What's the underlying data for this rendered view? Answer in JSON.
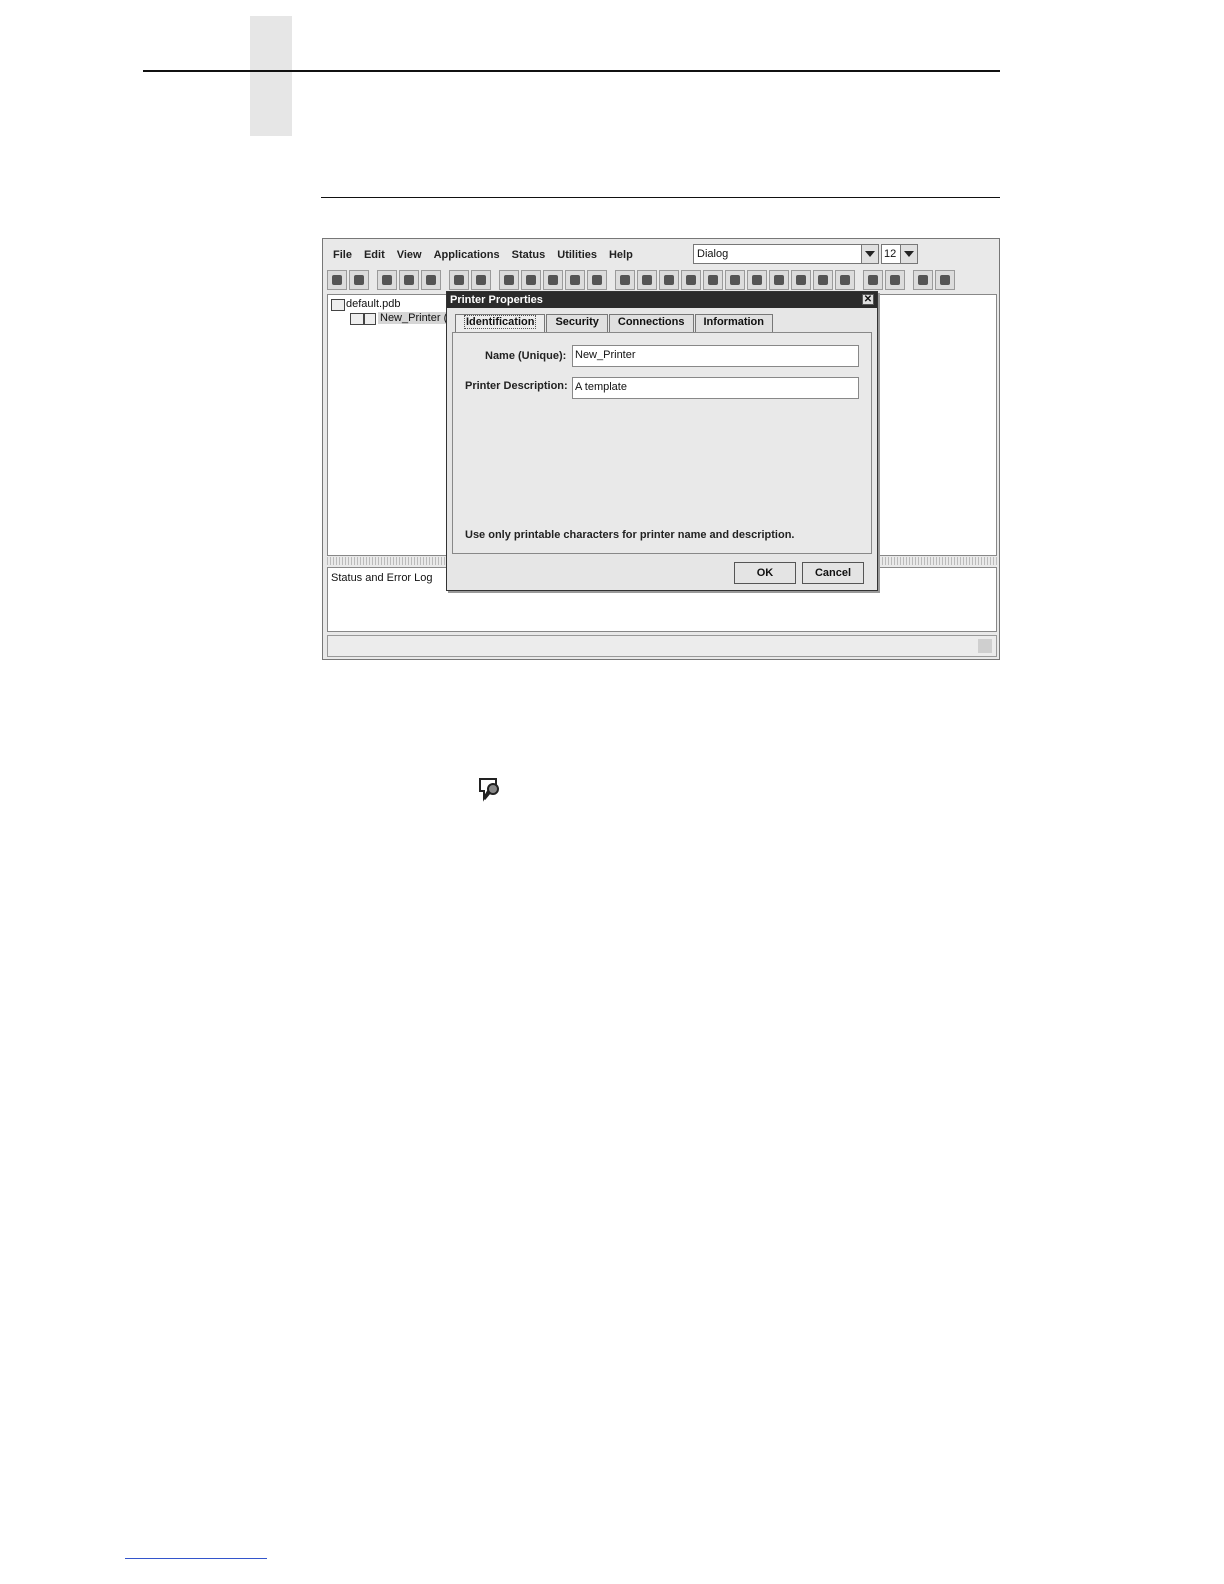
{
  "app": {
    "menu": [
      {
        "label": "File"
      },
      {
        "label": "Edit"
      },
      {
        "label": "View"
      },
      {
        "label": "Applications"
      },
      {
        "label": "Status"
      },
      {
        "label": "Utilities"
      },
      {
        "label": "Help"
      }
    ],
    "font_combo": {
      "value": "Dialog"
    },
    "size_combo": {
      "value": "12"
    },
    "tree": {
      "root": "default.pdb",
      "child": "New_Printer (A"
    },
    "log_label": "Status and Error Log"
  },
  "dialog": {
    "title": "Printer Properties",
    "tabs": [
      {
        "label": "Identification"
      },
      {
        "label": "Security"
      },
      {
        "label": "Connections"
      },
      {
        "label": "Information"
      }
    ],
    "name_label": "Name (Unique):",
    "name_value": "New_Printer",
    "desc_label": "Printer Description:",
    "desc_value": "A template",
    "note": "Use only printable characters for printer name and description.",
    "ok_label": "OK",
    "cancel_label": "Cancel"
  }
}
